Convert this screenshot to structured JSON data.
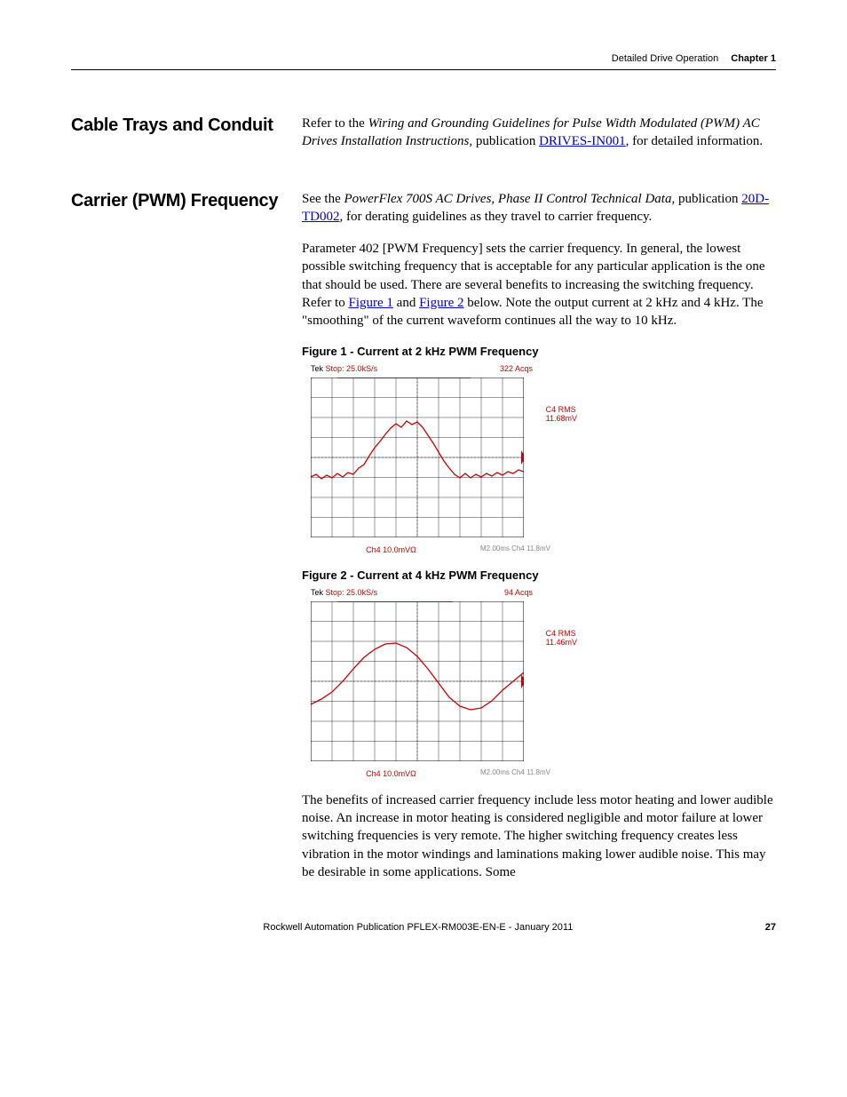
{
  "header": {
    "section_title": "Detailed Drive Operation",
    "chapter_label": "Chapter 1"
  },
  "sections": {
    "cable_trays": {
      "heading": "Cable Trays and Conduit",
      "p1_a": "Refer to the ",
      "p1_italic": "Wiring and Grounding Guidelines for Pulse Width Modulated (PWM) AC Drives Installation Instructions",
      "p1_b": ", publication ",
      "p1_link": "DRIVES-IN001",
      "p1_c": ", for detailed information."
    },
    "carrier": {
      "heading": "Carrier (PWM) Frequency",
      "p1_a": "See the ",
      "p1_italic": "PowerFlex 700S AC Drives, Phase II Control Technical Data",
      "p1_b": ", publication ",
      "p1_link": "20D-TD002",
      "p1_c": ", for derating guidelines as they travel to carrier frequency.",
      "p2_a": "Parameter 402 [PWM Frequency] sets the carrier frequency. In general, the lowest possible switching frequency that is acceptable for any particular application is the one that should be used. There are several benefits to increasing the switching frequency. Refer to ",
      "p2_link1": "Figure 1",
      "p2_b": " and ",
      "p2_link2": "Figure 2",
      "p2_c": " below. Note the output current at 2 kHz and 4 kHz. The \"smoothing\" of the current waveform continues all the way to 10 kHz.",
      "fig1_caption": "Figure 1 - Current at 2 kHz PWM Frequency",
      "fig2_caption": "Figure 2 - Current at 4 kHz PWM Frequency",
      "p3": "The benefits of increased carrier frequency include less motor heating and lower audible noise. An increase in motor heating is considered negligible and motor failure at lower switching frequencies is very remote. The higher switching frequency creates less vibration in the motor windings and laminations making lower audible noise. This may be desirable in some applications. Some"
    }
  },
  "scopes": {
    "fig1": {
      "top_left_a": "Tek",
      "top_left_b": "Stop: 25.0kS/s",
      "top_right": "322 Acqs",
      "right_a": "C4 RMS",
      "right_b": "11.68mV",
      "bottom_main": "Ch4  10.0mVΩ",
      "bottom_grey": "M2.00ms  Ch4      11.8mV"
    },
    "fig2": {
      "top_left_a": "Tek",
      "top_left_b": "Stop: 25.0kS/s",
      "top_right": "94 Acqs",
      "right_a": "C4 RMS",
      "right_b": "11.46mV",
      "bottom_main": "Ch4  10.0mVΩ",
      "bottom_grey": "M2.00ms  Ch4      11.8mV"
    }
  },
  "footer": {
    "pub": "Rockwell Automation Publication PFLEX-RM003E-EN-E - January 2011",
    "page": "27"
  },
  "chart_data": [
    {
      "type": "line",
      "title": "Current at 2 kHz PWM Frequency",
      "xlabel": "Time (M2.00ms/div)",
      "ylabel": "Ch4 10.0mVΩ/div",
      "annotations": [
        "Tek Stop: 25.0kS/s",
        "322 Acqs",
        "C4 RMS 11.68mV"
      ],
      "x": [
        0,
        1,
        2,
        3,
        4,
        5,
        6,
        7,
        8,
        9,
        10
      ],
      "series": [
        {
          "name": "Ch4 (2 kHz)",
          "values": [
            -8,
            -8,
            -6,
            4,
            14,
            16,
            10,
            -2,
            -8,
            -8,
            -6
          ]
        }
      ],
      "ylim": [
        -40,
        40
      ]
    },
    {
      "type": "line",
      "title": "Current at 4 kHz PWM Frequency",
      "xlabel": "Time (M2.00ms/div)",
      "ylabel": "Ch4 10.0mVΩ/div",
      "annotations": [
        "Tek Stop: 25.0kS/s",
        "94 Acqs",
        "C4 RMS 11.46mV"
      ],
      "x": [
        0,
        1,
        2,
        3,
        4,
        5,
        6,
        7,
        8,
        9,
        10
      ],
      "series": [
        {
          "name": "Ch4 (4 kHz)",
          "values": [
            -10,
            -6,
            6,
            14,
            16,
            10,
            0,
            -10,
            -14,
            -8,
            2
          ]
        }
      ],
      "ylim": [
        -40,
        40
      ]
    }
  ]
}
